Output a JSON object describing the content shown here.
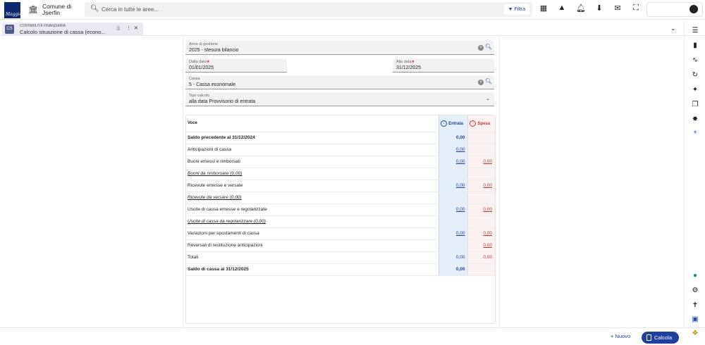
{
  "header": {
    "logo_text": "Maggioli",
    "comune_name": "Comune di Jserfin",
    "search_placeholder": "Cerca in tutte le aree...",
    "filter_label": "Filtra"
  },
  "tab": {
    "category": "CONTABILITÀ FINANZIARIA",
    "title": "Calcolo situazione di cassa (econo...",
    "icon_text": "CS"
  },
  "form": {
    "anno_label": "Anno di gestione",
    "anno_value": "2025 - stesura bilancio",
    "dalla_label": "Dalla data",
    "dalla_value": "01/01/2025",
    "alla_label": "Alla data",
    "alla_value": "31/12/2025",
    "cassa_label": "Cassa",
    "cassa_value": "5 - Cassa economale",
    "tipo_label": "Tipo calcolo",
    "tipo_value": "alla data Provvisorio di entrata"
  },
  "table": {
    "col_voce": "Voce",
    "col_entrata": "Entrata",
    "col_spesa": "Spesa",
    "rows": [
      {
        "voce": "Saldo precedente al 31/12/2024",
        "entrata": "0,00",
        "spesa": ""
      },
      {
        "voce": "Anticipazioni di cassa",
        "entrata": "0,00",
        "spesa": ""
      },
      {
        "voce": "Buoni emessi e rimborsati",
        "entrata": "0,00",
        "spesa": "0,00"
      },
      {
        "voce": "Buoni da rimborsare (0,00)",
        "entrata": "",
        "spesa": ""
      },
      {
        "voce": "Ricevute emesse e versate",
        "entrata": "0,00",
        "spesa": "0,00"
      },
      {
        "voce": "Ricevute da versare (0,00)",
        "entrata": "",
        "spesa": ""
      },
      {
        "voce": "Uscite di cassa emesse e regolarizzate",
        "entrata": "0,00",
        "spesa": "0,00"
      },
      {
        "voce": "Uscite di cassa da regolarizzare (0,00)",
        "entrata": "",
        "spesa": ""
      },
      {
        "voce": "Variazioni per spostamenti di cassa",
        "entrata": "0,00",
        "spesa": "0,00"
      },
      {
        "voce": "Reversali di restituzione anticipazioni",
        "entrata": "",
        "spesa": "0,00"
      },
      {
        "voce": "Totali",
        "entrata": "0,00",
        "spesa": "0,00"
      },
      {
        "voce": "Saldo di cassa al 31/12/2025",
        "entrata": "0,00",
        "spesa": ""
      }
    ]
  },
  "actions": {
    "nuovo_label": "Nuovo",
    "calcola_label": "Calcola"
  }
}
